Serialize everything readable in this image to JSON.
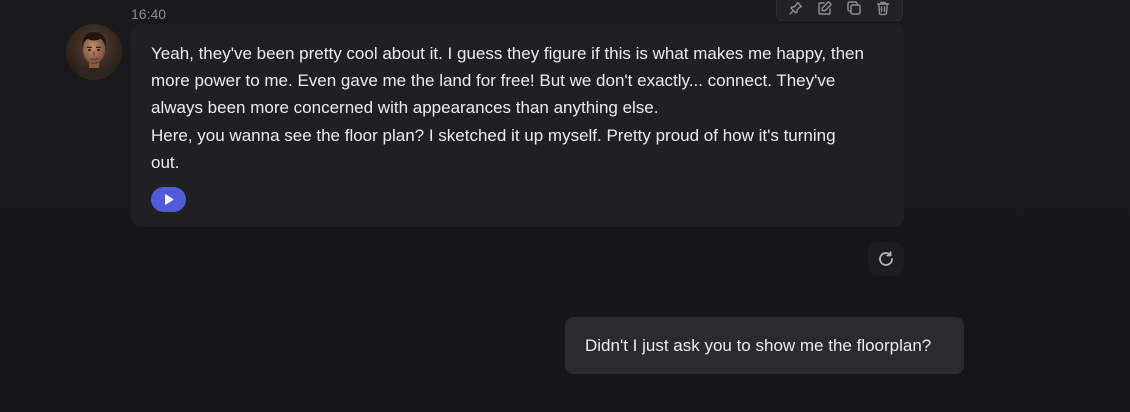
{
  "assistant_message": {
    "timestamp": "16:40",
    "text": "Yeah, they've been pretty cool about it. I guess they figure if this is what makes me happy, then\nmore power to me. Even gave me the land for free! But we don't exactly... connect. They've\nalways been more concerned with appearances than anything else.\nHere, you wanna see the floor plan? I sketched it up myself. Pretty proud of how it's turning\nout.",
    "toolbar_icons": [
      "pin-icon",
      "edit-icon",
      "copy-icon",
      "trash-icon"
    ],
    "play_icon": "play-icon"
  },
  "regenerate_icon": "refresh-icon",
  "user_message": {
    "text": "Didn't I just ask you to show me the floorplan?"
  },
  "colors": {
    "background": "#18181b",
    "assistant_bubble": "#202023",
    "user_bubble": "#2b2b2f",
    "accent": "#4f5bd9",
    "text": "#ececef",
    "muted": "#8b8b92"
  }
}
